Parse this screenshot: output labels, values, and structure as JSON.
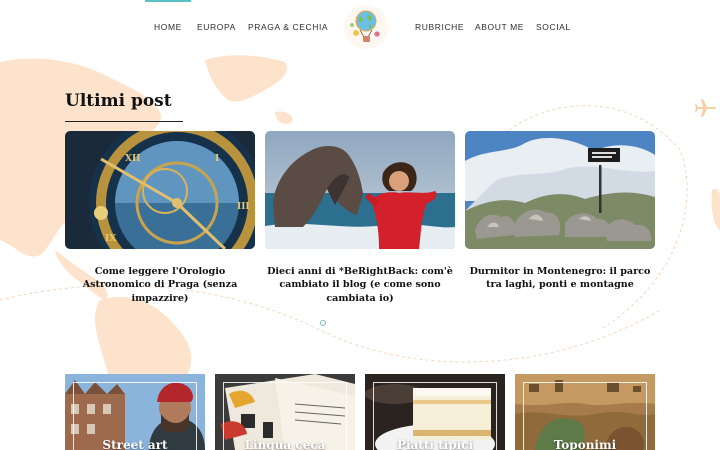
{
  "nav": {
    "left": [
      "HOME",
      "EUROPA",
      "PRAGA & CECHIA"
    ],
    "right": [
      "RUBRICHE",
      "ABOUT ME",
      "SOCIAL"
    ],
    "active": "HOME"
  },
  "section": {
    "title": "Ultimi post"
  },
  "posts": [
    {
      "title": "Come leggere l'Orologio Astronomico di Praga (senza impazzire)"
    },
    {
      "title": "Dieci anni di *BeRightBack: com'è cambiato il blog (e come sono cambiata io)"
    },
    {
      "title": "Durmitor in Montenegro: il parco tra laghi, ponti e montagne"
    }
  ],
  "categories": [
    {
      "label": "Street art"
    },
    {
      "label": "Lingua ceca"
    },
    {
      "label": "Piatti tipici"
    },
    {
      "label": "Toponimi"
    }
  ],
  "colors": {
    "accent": "#5bc1c8",
    "map": "#fde3cb"
  },
  "icons": {
    "logo": "globe-balloon-logo",
    "decor": "plane-icon"
  }
}
